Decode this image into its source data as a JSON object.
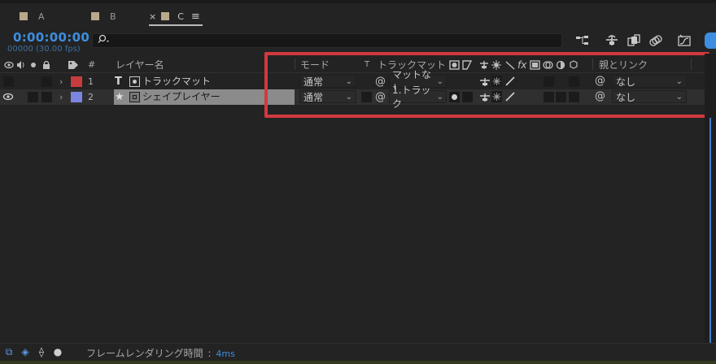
{
  "tabs": [
    {
      "label": "A",
      "active": false
    },
    {
      "label": "B",
      "active": false
    },
    {
      "label": "C",
      "active": true,
      "close": "×",
      "menu": "≡"
    }
  ],
  "timecode": "0:00:00:00",
  "fps": "00000 (30.00 fps)",
  "search": {
    "icon": "search-icon",
    "placeholder": ""
  },
  "toolbar_icons": [
    "composition-flowchart-icon",
    "draft-3d-icon",
    "frame-blending-icon",
    "motion-blur-icon",
    "graph-editor-icon"
  ],
  "columns": {
    "hash": "#",
    "layer_name": "レイヤー名",
    "mode": "モード",
    "t": "T",
    "track_matte": "トラックマット",
    "fx": "fx",
    "parent_link": "親とリンク"
  },
  "layers": [
    {
      "index": "1",
      "type_icon": "T",
      "name": "トラックマット",
      "color": "#c73c3c",
      "visible": false,
      "mode": "通常",
      "track_matte": "マットなし",
      "parent": "なし"
    },
    {
      "index": "2",
      "type_icon": "★",
      "name": "シェイプレイヤー",
      "color": "#7c86e0",
      "visible": true,
      "mode": "通常",
      "track_matte": "1.トラック",
      "parent": "なし"
    }
  ],
  "footer": {
    "label": "フレームレンダリング時間",
    "separator": ":",
    "value": "4ms"
  },
  "colors": {
    "accent": "#3d8ee0",
    "highlight": "#d1393f"
  }
}
